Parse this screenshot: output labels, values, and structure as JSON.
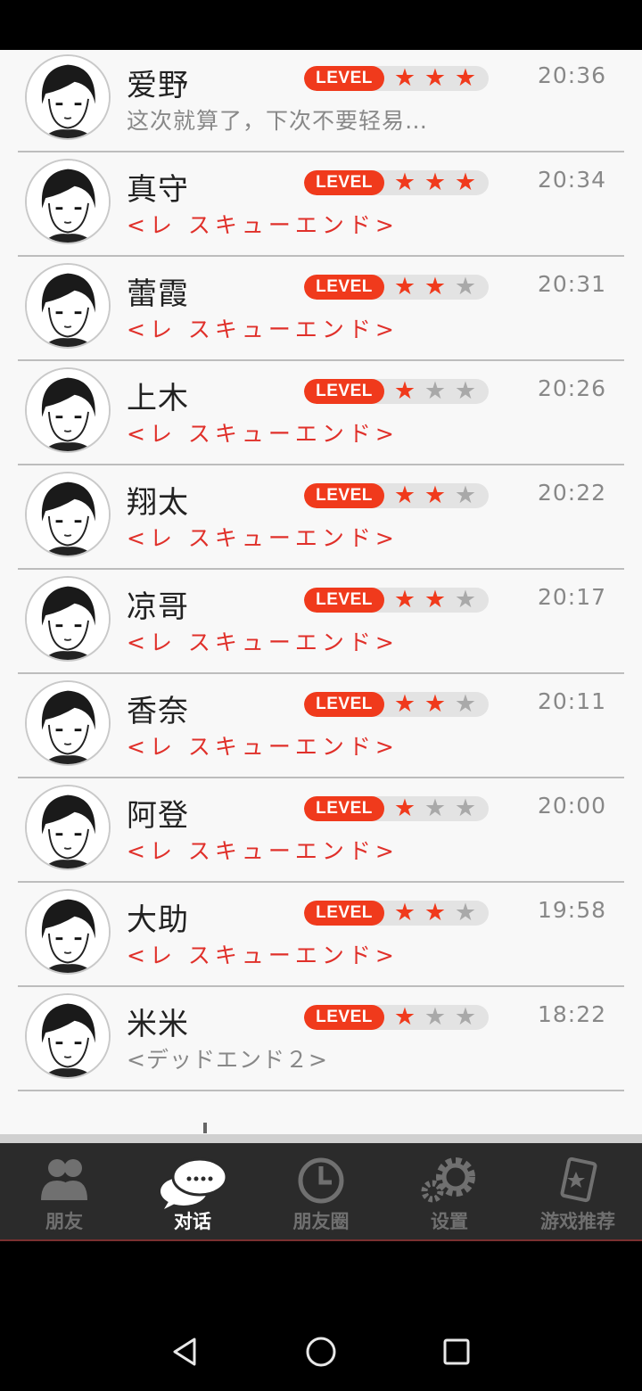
{
  "conversations": [
    {
      "name": "爱野",
      "message": "这次就算了，下次不要轻易…",
      "message_style": "gray",
      "stars": 3,
      "time": "20:36",
      "accent": "#8a1f8a"
    },
    {
      "name": "真守",
      "message": "<レ スキューエンド>",
      "message_style": "red",
      "stars": 3,
      "time": "20:34",
      "accent": "#1b6fd6"
    },
    {
      "name": "蕾霞",
      "message": "<レ スキューエンド>",
      "message_style": "red",
      "stars": 2,
      "time": "20:31",
      "accent": "#d84040"
    },
    {
      "name": "上木",
      "message": "<レ スキューエンド>",
      "message_style": "red",
      "stars": 1,
      "time": "20:26",
      "accent": "#20c8b0"
    },
    {
      "name": "翔太",
      "message": "<レ スキューエンド>",
      "message_style": "red",
      "stars": 2,
      "time": "20:22",
      "accent": "#2cb030"
    },
    {
      "name": "凉哥",
      "message": "<レ スキューエンド>",
      "message_style": "red",
      "stars": 2,
      "time": "20:17",
      "accent": "#6a3ab0"
    },
    {
      "name": "香奈",
      "message": "<レ スキューエンド>",
      "message_style": "red",
      "stars": 2,
      "time": "20:11",
      "accent": "#d82020"
    },
    {
      "name": "阿登",
      "message": "<レ スキューエンド>",
      "message_style": "red",
      "stars": 1,
      "time": "20:00",
      "accent": "#e8b820"
    },
    {
      "name": "大助",
      "message": "<レ スキューエンド>",
      "message_style": "red",
      "stars": 2,
      "time": "19:58",
      "accent": "#2a8ae0"
    },
    {
      "name": "米米",
      "message": "<デッドエンド２>",
      "message_style": "gray",
      "stars": 1,
      "time": "18:22",
      "accent": "#e02a80"
    }
  ],
  "level_label": "LEVEL",
  "colors": {
    "level_red": "#f03a1c",
    "message_red": "#e0302a",
    "tabbar_bg": "#2b2b2b"
  },
  "tabs": [
    {
      "label": "朋友",
      "icon": "friends-icon",
      "active": false
    },
    {
      "label": "对话",
      "icon": "chat-bubble-icon",
      "active": true
    },
    {
      "label": "朋友圈",
      "icon": "clock-icon",
      "active": false
    },
    {
      "label": "设置",
      "icon": "gear-icon",
      "active": false
    },
    {
      "label": "游戏推荐",
      "icon": "game-card-icon",
      "active": false
    }
  ]
}
